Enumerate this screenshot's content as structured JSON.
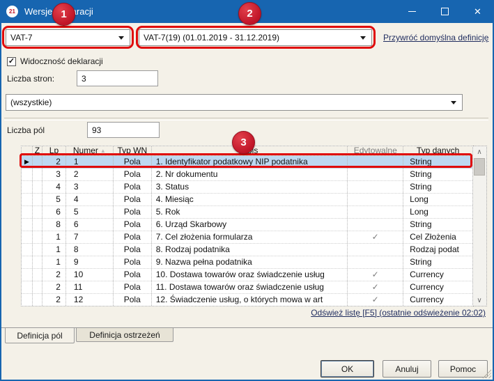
{
  "window": {
    "title": "Wersje deklaracji",
    "icon_text": "21",
    "controls": {
      "minimize": "minimize",
      "maximize": "maximize",
      "close": "close"
    }
  },
  "callouts": {
    "badge1": "1",
    "badge2": "2",
    "badge3": "3"
  },
  "selectors": {
    "form_combo_value": "VAT-7",
    "version_combo_value": "VAT-7(19) (01.01.2019 - 31.12.2019)",
    "restore_link": "Przywróć domyślna definicję"
  },
  "fields": {
    "visibility_label": "Widoczność deklaracji",
    "visibility_checked": true,
    "check_glyph": "✓",
    "pages_label": "Liczba stron:",
    "pages_value": "3",
    "filter_combo_value": "(wszystkie)",
    "field_count_label": "Liczba pól",
    "field_count_value": "93"
  },
  "table": {
    "columns": [
      "",
      "Z",
      "Lp",
      "Numer",
      "Typ WN",
      "Opis",
      "Edytowalne",
      "Typ danych"
    ],
    "sort_column": "Numer",
    "sort_icon": "▲",
    "row_marker": "▶",
    "check_glyph": "✓",
    "rows": [
      {
        "selected": true,
        "z": "",
        "lp": "2",
        "numer": "1",
        "typ_wn": "Pola",
        "opis": "1. Identyfikator podatkowy NIP podatnika",
        "edytowalne": false,
        "typ_danych": "String"
      },
      {
        "selected": false,
        "z": "",
        "lp": "3",
        "numer": "2",
        "typ_wn": "Pola",
        "opis": "2. Nr dokumentu",
        "edytowalne": false,
        "typ_danych": "String"
      },
      {
        "selected": false,
        "z": "",
        "lp": "4",
        "numer": "3",
        "typ_wn": "Pola",
        "opis": "3. Status",
        "edytowalne": false,
        "typ_danych": "String"
      },
      {
        "selected": false,
        "z": "",
        "lp": "5",
        "numer": "4",
        "typ_wn": "Pola",
        "opis": "4. Miesiąc",
        "edytowalne": false,
        "typ_danych": "Long"
      },
      {
        "selected": false,
        "z": "",
        "lp": "6",
        "numer": "5",
        "typ_wn": "Pola",
        "opis": "5. Rok",
        "edytowalne": false,
        "typ_danych": "Long"
      },
      {
        "selected": false,
        "z": "",
        "lp": "8",
        "numer": "6",
        "typ_wn": "Pola",
        "opis": "6. Urząd Skarbowy",
        "edytowalne": false,
        "typ_danych": "String"
      },
      {
        "selected": false,
        "z": "",
        "lp": "1",
        "numer": "7",
        "typ_wn": "Pola",
        "opis": "7. Cel złożenia formularza",
        "edytowalne": true,
        "typ_danych": "Cel Złożenia"
      },
      {
        "selected": false,
        "z": "",
        "lp": "1",
        "numer": "8",
        "typ_wn": "Pola",
        "opis": "8. Rodzaj podatnika",
        "edytowalne": false,
        "typ_danych": "Rodzaj podat"
      },
      {
        "selected": false,
        "z": "",
        "lp": "1",
        "numer": "9",
        "typ_wn": "Pola",
        "opis": "9. Nazwa pełna podatnika",
        "edytowalne": false,
        "typ_danych": "String"
      },
      {
        "selected": false,
        "z": "",
        "lp": "2",
        "numer": "10",
        "typ_wn": "Pola",
        "opis": "10. Dostawa towarów oraz świadczenie usług",
        "edytowalne": true,
        "typ_danych": "Currency"
      },
      {
        "selected": false,
        "z": "",
        "lp": "2",
        "numer": "11",
        "typ_wn": "Pola",
        "opis": "11. Dostawa towarów oraz świadczenie usług",
        "edytowalne": true,
        "typ_danych": "Currency"
      },
      {
        "selected": false,
        "z": "",
        "lp": "2",
        "numer": "12",
        "typ_wn": "Pola",
        "opis": "12. Świadczenie usług, o których mowa w art",
        "edytowalne": true,
        "typ_danych": "Currency"
      }
    ],
    "refresh_link": "Odśwież listę [F5] (ostatnie odświeżenie 02:02)"
  },
  "tabs": [
    {
      "label": "Definicja pól",
      "active": true
    },
    {
      "label": "Definicja ostrzeżeń",
      "active": false
    }
  ],
  "footer": {
    "ok": "OK",
    "cancel": "Anuluj",
    "help": "Pomoc"
  },
  "colors": {
    "titlebar": "#1765b0",
    "dialog_bg": "#f4f1e8",
    "callout_red": "#e00b0b",
    "badge_red": "#c01527",
    "row_highlight": "#bdd8f1"
  }
}
